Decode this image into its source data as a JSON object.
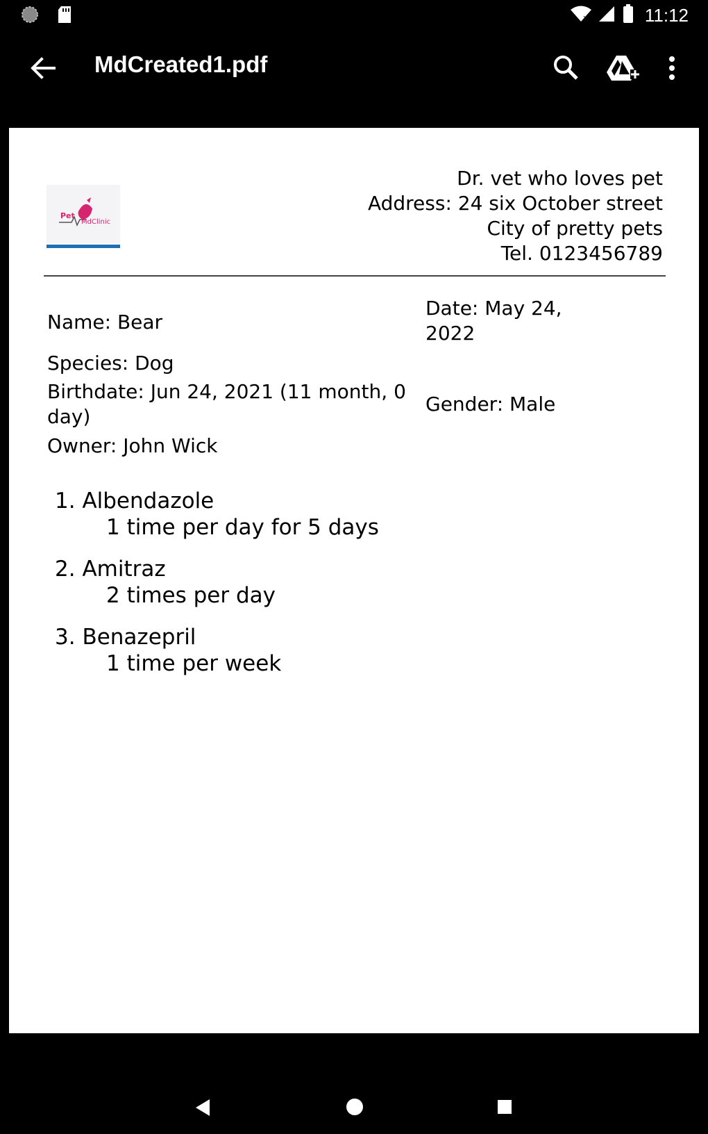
{
  "status_bar": {
    "time": "11:12",
    "icons": [
      "spinner-icon",
      "sd-card-icon",
      "wifi-icon",
      "signal-icon",
      "battery-icon"
    ]
  },
  "app_bar": {
    "title": "MdCreated1.pdf",
    "icons": [
      "back-arrow-icon",
      "search-icon",
      "drive-add-icon",
      "more-vert-icon"
    ]
  },
  "document": {
    "logo": {
      "text_pet": "Pet",
      "text_clinic": "MdClinic",
      "brand_color": "#d6246e",
      "accent_color": "#1e6fb3"
    },
    "clinic": {
      "doctor": "Dr. vet who loves pet",
      "address": "Address: 24 six October street",
      "city": "City of pretty pets",
      "tel": "Tel. 0123456789"
    },
    "patient": {
      "name": "Name: Bear",
      "species": "Species: Dog",
      "birthdate_line1": "Birthdate: Jun 24, 2021 (11 month, 0",
      "birthdate_line2": "day)",
      "owner": "Owner: John Wick",
      "date_line1": "Date: May 24,",
      "date_line2": "2022",
      "gender": "Gender: Male"
    },
    "prescriptions": [
      {
        "number": "1.",
        "drug": "Albendazole",
        "dose": "1 time per day for 5 days"
      },
      {
        "number": "2.",
        "drug": "Amitraz",
        "dose": "2 times per day"
      },
      {
        "number": "3.",
        "drug": "Benazepril",
        "dose": "1 time per week"
      }
    ]
  },
  "nav_bar": {
    "icons": [
      "nav-back-icon",
      "nav-home-icon",
      "nav-recents-icon"
    ]
  }
}
